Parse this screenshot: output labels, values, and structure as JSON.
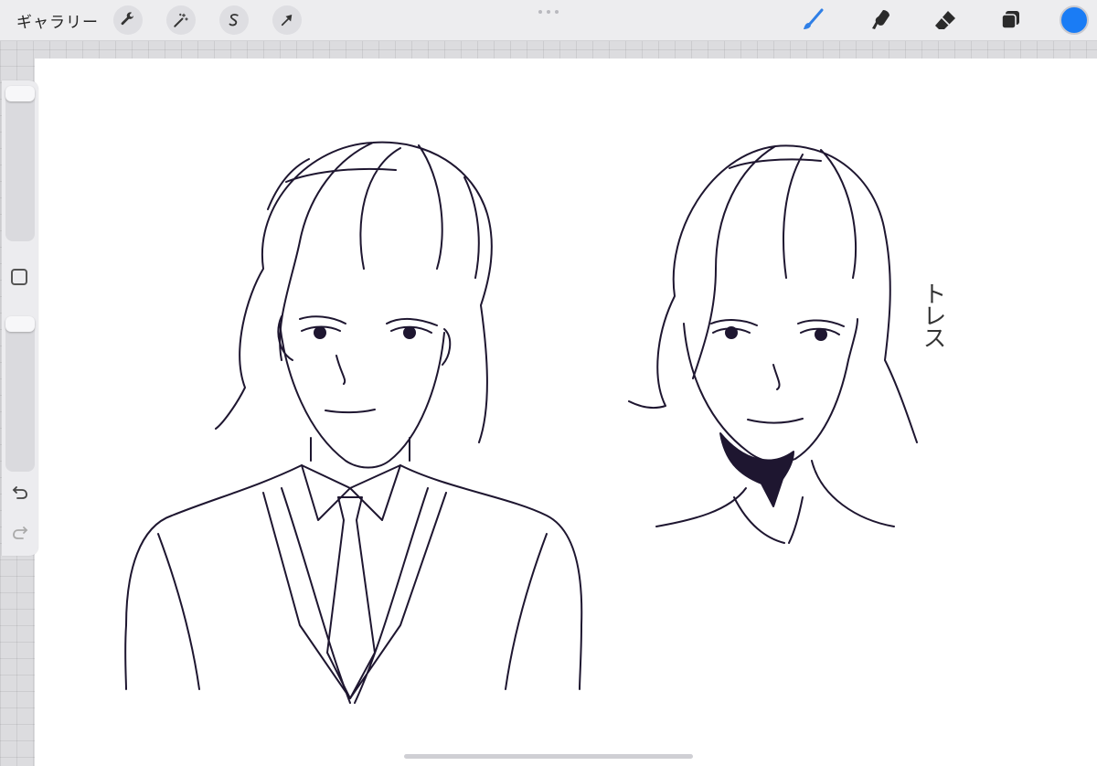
{
  "toolbar": {
    "gallery_label": "ギャラリー",
    "left_tools": [
      {
        "name": "actions",
        "icon": "wrench-icon"
      },
      {
        "name": "adjustments",
        "icon": "magic-wand-icon"
      },
      {
        "name": "selection",
        "icon": "selection-s-icon"
      },
      {
        "name": "transform",
        "icon": "arrow-cursor-icon"
      }
    ],
    "right_tools": [
      {
        "name": "brush",
        "icon": "brush-icon",
        "active": true
      },
      {
        "name": "smudge",
        "icon": "smudge-icon",
        "active": false
      },
      {
        "name": "eraser",
        "icon": "eraser-icon",
        "active": false
      },
      {
        "name": "layers",
        "icon": "layers-icon",
        "active": false
      }
    ],
    "current_color": "#1a7cf5",
    "active_color": "#2f7fe6"
  },
  "sidebar": {
    "brush_size_level": 0.0,
    "opacity_level": 0.0,
    "modify_icon": "square-icon",
    "undo_icon": "undo-icon",
    "redo_icon": "redo-icon"
  },
  "canvas": {
    "background": "#ffffff",
    "ink_color": "#1e1630",
    "annotation_text": "トレス"
  }
}
